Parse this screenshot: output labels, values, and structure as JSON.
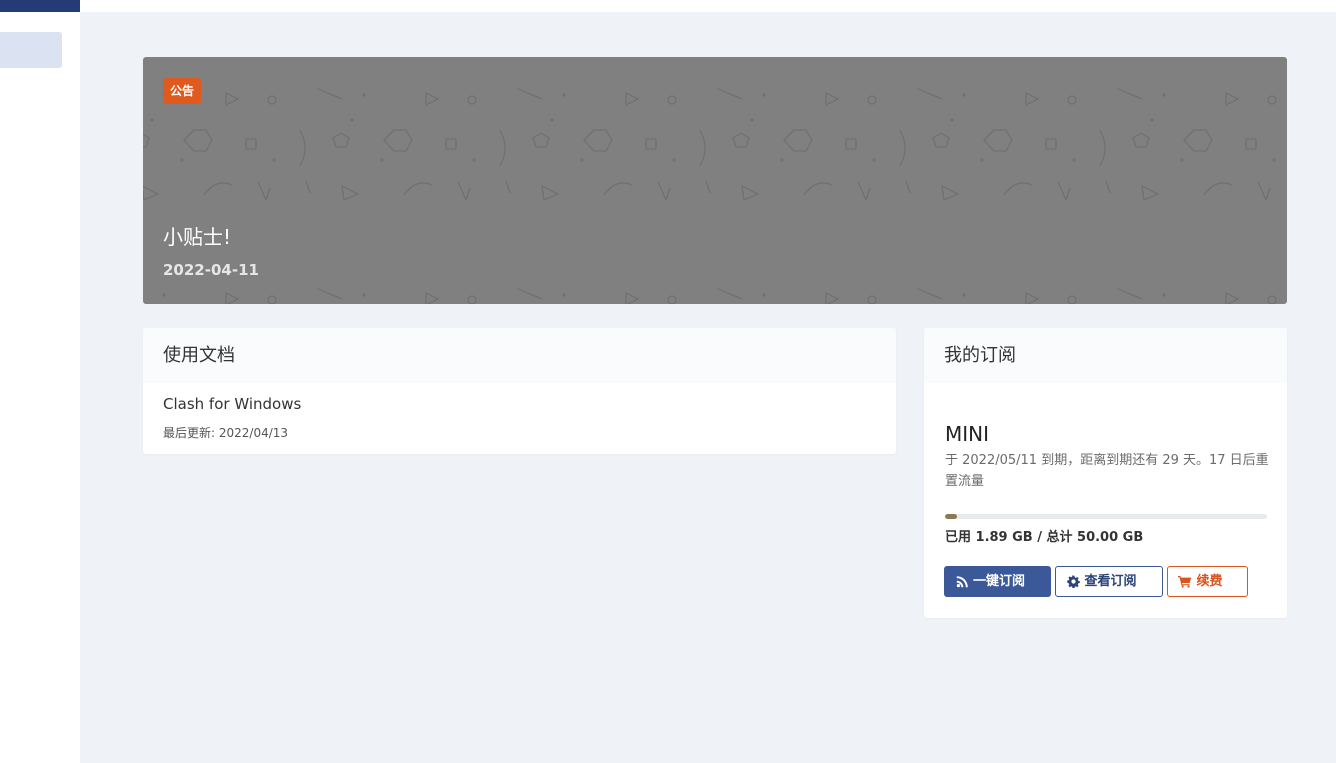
{
  "announcement": {
    "badge": "公告",
    "title": "小贴士!",
    "date": "2022-04-11"
  },
  "docs_card": {
    "title": "使用文档",
    "items": [
      {
        "title": "Clash for Windows",
        "updated": "最后更新: 2022/04/13"
      }
    ]
  },
  "subscription_card": {
    "title": "我的订阅",
    "plan": "MINI",
    "description": "于 2022/05/11 到期，距离到期还有 29 天。17 日后重置流量",
    "usage_text": "已用 1.89 GB / 总计 50.00 GB",
    "used_fraction": 0.0378,
    "buttons": {
      "one_click": "一键订阅",
      "view": "查看订阅",
      "renew": "续费"
    }
  },
  "colors": {
    "brand": "#243b76",
    "primary": "#3b5998",
    "warning": "#d9541e",
    "badge": "#e05a1e"
  },
  "icons": [
    "rss-icon",
    "gear-icon",
    "cart-icon"
  ]
}
